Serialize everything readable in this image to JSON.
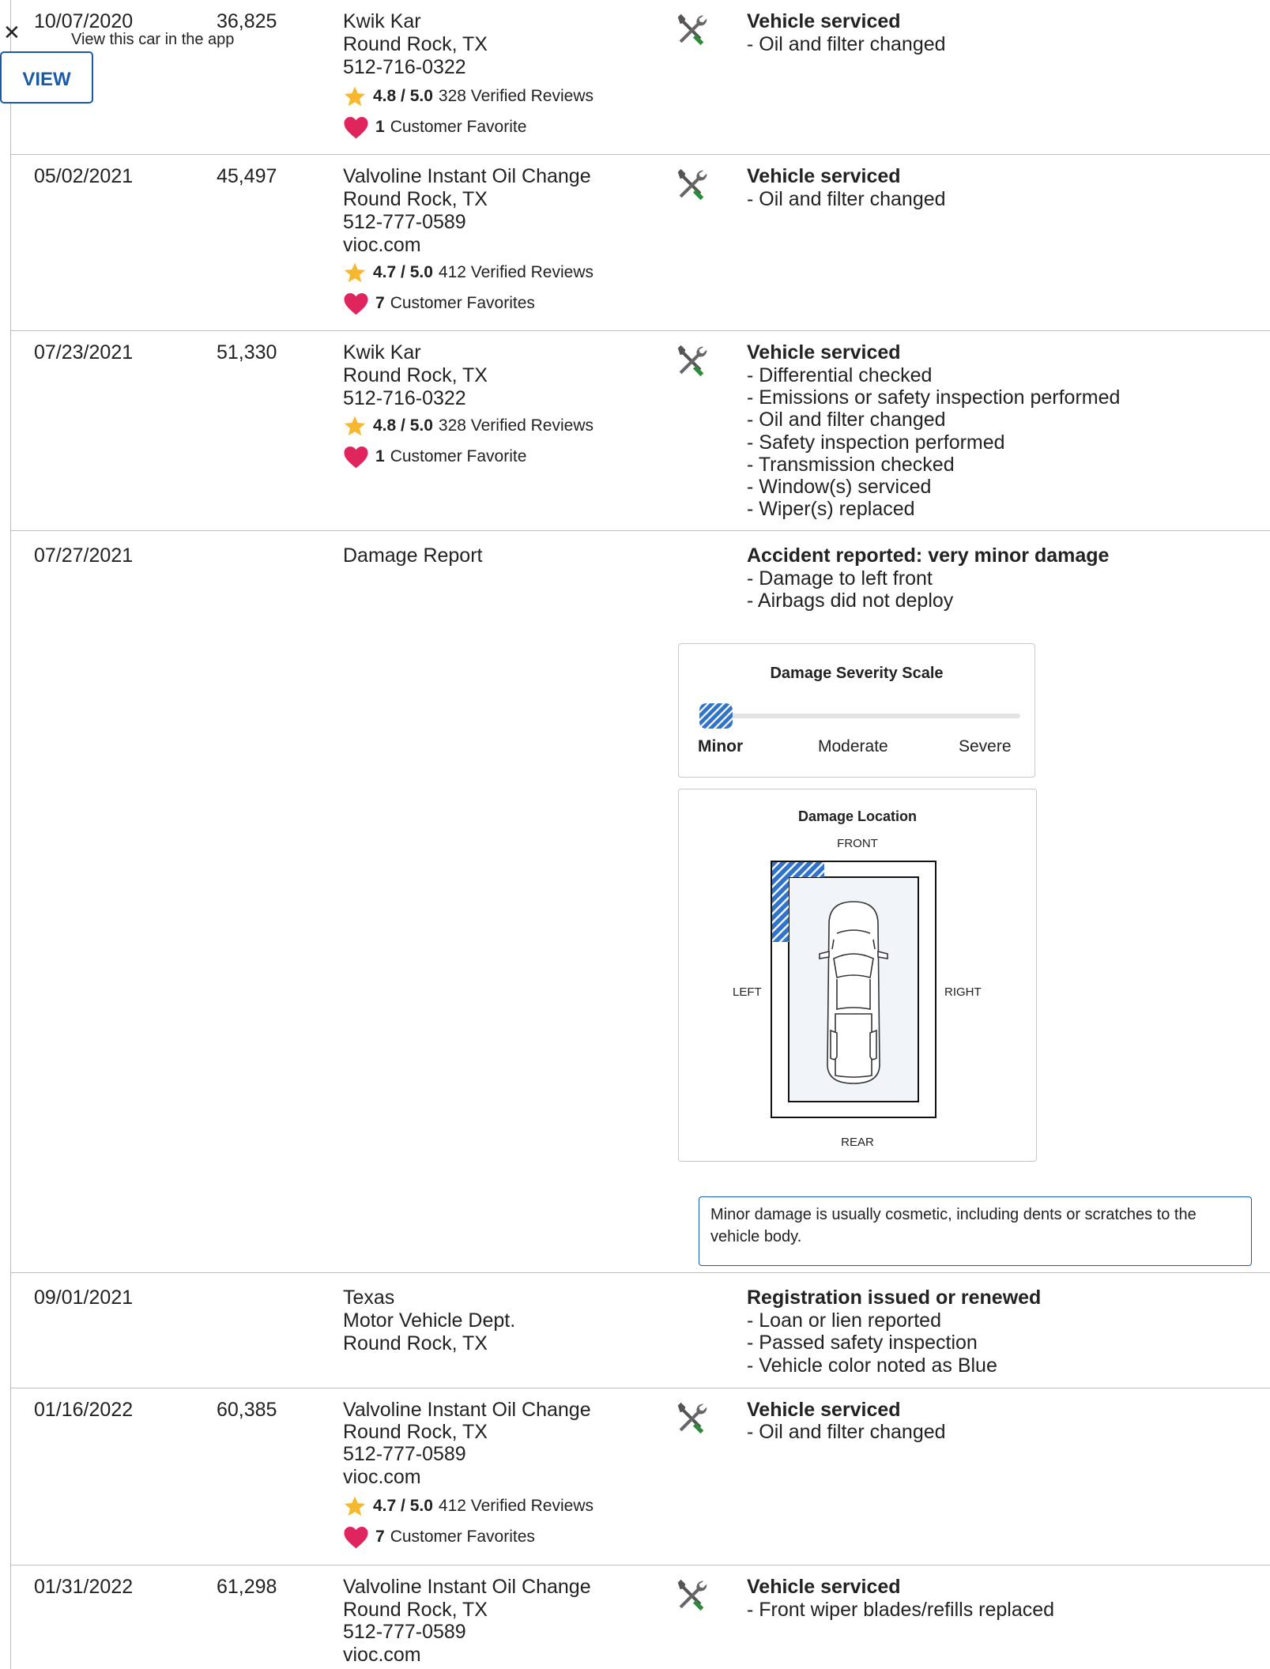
{
  "banner": {
    "close_icon": "close-icon",
    "text": "View this car in the app",
    "button_label": "VIEW",
    "accent_color": "#1a5aa8"
  },
  "records": [
    {
      "date": "10/07/2020",
      "odometer": "36,825",
      "source_lines": [
        "Kwik Kar",
        "Round Rock, TX",
        "512-716-0322"
      ],
      "rating": "4.8 / 5.0",
      "reviews": "328 Verified Reviews",
      "favorites_count": "1",
      "favorites_label": "Customer Favorite",
      "icon": "wrench-screwdriver-icon",
      "detail_title": "Vehicle serviced",
      "detail_items": [
        "- Oil and filter changed"
      ]
    },
    {
      "date": "05/02/2021",
      "odometer": "45,497",
      "source_lines": [
        "Valvoline Instant Oil Change",
        "Round Rock, TX",
        "512-777-0589",
        "vioc.com"
      ],
      "rating": "4.7 / 5.0",
      "reviews": "412 Verified Reviews",
      "favorites_count": "7",
      "favorites_label": "Customer Favorites",
      "icon": "wrench-screwdriver-icon",
      "detail_title": "Vehicle serviced",
      "detail_items": [
        "- Oil and filter changed"
      ]
    },
    {
      "date": "07/23/2021",
      "odometer": "51,330",
      "source_lines": [
        "Kwik Kar",
        "Round Rock, TX",
        "512-716-0322"
      ],
      "rating": "4.8 / 5.0",
      "reviews": "328 Verified Reviews",
      "favorites_count": "1",
      "favorites_label": "Customer Favorite",
      "icon": "wrench-screwdriver-icon",
      "detail_title": "Vehicle serviced",
      "detail_items": [
        "- Differential checked",
        "- Emissions or safety inspection performed",
        "- Oil and filter changed",
        "- Safety inspection performed",
        "- Transmission checked",
        "- Window(s) serviced",
        "- Wiper(s) replaced"
      ]
    },
    {
      "date": "07/27/2021",
      "odometer": "",
      "source_lines": [
        "Damage Report"
      ],
      "detail_title": "Accident reported: very minor damage",
      "detail_items": [
        "- Damage to left front",
        "- Airbags did not deploy"
      ],
      "severity": {
        "title": "Damage Severity Scale",
        "labels": [
          "Minor",
          "Moderate",
          "Severe"
        ],
        "selected": "Minor"
      },
      "location": {
        "title": "Damage Location",
        "front": "FRONT",
        "rear": "REAR",
        "left": "LEFT",
        "right": "RIGHT",
        "damaged_zone": "left-front"
      },
      "note": "Minor damage is usually cosmetic, including dents or scratches to the vehicle body."
    },
    {
      "date": "09/01/2021",
      "odometer": "",
      "source_lines": [
        "Texas",
        "Motor Vehicle Dept.",
        "Round Rock, TX"
      ],
      "detail_title": "Registration issued or renewed",
      "detail_items": [
        "- Loan or lien reported",
        "- Passed safety inspection",
        "- Vehicle color noted as Blue"
      ]
    },
    {
      "date": "01/16/2022",
      "odometer": "60,385",
      "source_lines": [
        "Valvoline Instant Oil Change",
        "Round Rock, TX",
        "512-777-0589",
        "vioc.com"
      ],
      "rating": "4.7 / 5.0",
      "reviews": "412 Verified Reviews",
      "favorites_count": "7",
      "favorites_label": "Customer Favorites",
      "icon": "wrench-screwdriver-icon",
      "detail_title": "Vehicle serviced",
      "detail_items": [
        "- Oil and filter changed"
      ]
    },
    {
      "date": "01/31/2022",
      "odometer": "61,298",
      "source_lines": [
        "Valvoline Instant Oil Change",
        "Round Rock, TX",
        "512-777-0589",
        "vioc.com"
      ],
      "icon": "wrench-screwdriver-icon",
      "detail_title": "Vehicle serviced",
      "detail_items": [
        "- Front wiper blades/refills replaced"
      ]
    }
  ],
  "colors": {
    "star": "#f5b82e",
    "heart": "#e0245e",
    "screwdriver": "#2e8b3a",
    "damage_hatch": "#2f74c8",
    "divider": "#bdbdbd"
  }
}
